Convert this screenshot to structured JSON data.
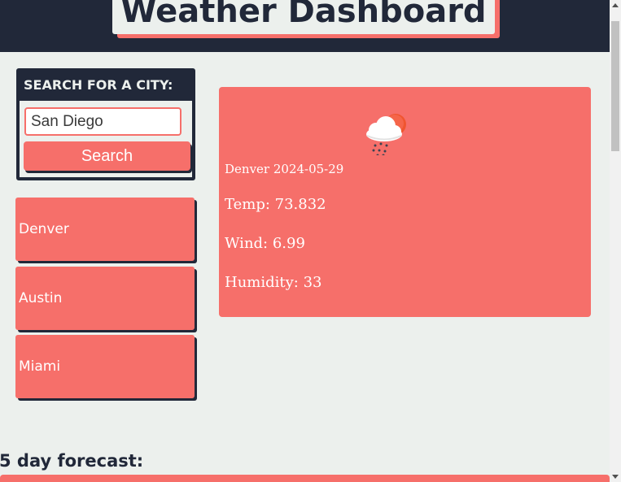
{
  "header": {
    "title": "Weather Dashboard"
  },
  "search": {
    "heading": "SEARCH FOR A CITY:",
    "input_value": "San Diego",
    "button_label": "Search"
  },
  "history": {
    "cities": [
      "Denver",
      "Austin",
      "Miami"
    ]
  },
  "current": {
    "icon": "rain-cloud-sun-icon",
    "city_date": "Denver 2024-05-29",
    "temp": "Temp: 73.832",
    "wind": "Wind: 6.99",
    "humidity": "Humidity: 33"
  },
  "forecast": {
    "heading": "5 day forecast:"
  },
  "colors": {
    "navy": "#212839",
    "coral": "#f66f6a",
    "background": "#ecf0ed"
  }
}
